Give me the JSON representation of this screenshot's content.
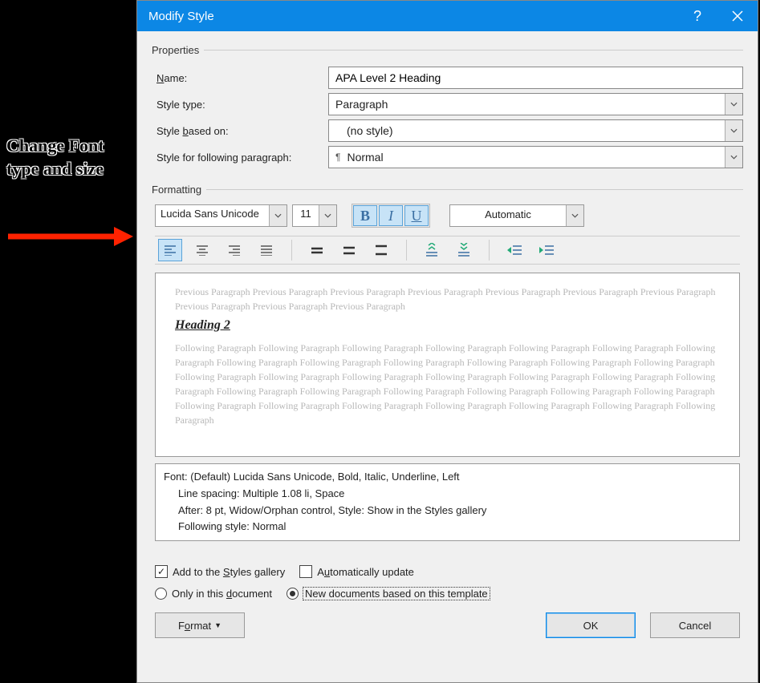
{
  "annotation": {
    "text": "Change Font type and size"
  },
  "dialog": {
    "title": "Modify Style",
    "help_icon": "?",
    "close_icon": "×"
  },
  "properties": {
    "legend": "Properties",
    "name_label": "Name:",
    "name_value": "APA Level 2 Heading",
    "type_label": "Style type:",
    "type_value": "Paragraph",
    "based_label": "Style based on:",
    "based_value": "(no style)",
    "follow_label": "Style for following paragraph:",
    "follow_value": "Normal"
  },
  "formatting": {
    "legend": "Formatting",
    "font_name": "Lucida Sans Unicode",
    "font_size": "11",
    "bold": "B",
    "italic": "I",
    "underline": "U",
    "color_auto": "Automatic"
  },
  "preview": {
    "prev_text": "Previous Paragraph Previous Paragraph Previous Paragraph Previous Paragraph Previous Paragraph Previous Paragraph Previous Paragraph Previous Paragraph Previous Paragraph Previous Paragraph",
    "heading": "Heading 2",
    "follow_text": "Following Paragraph Following Paragraph Following Paragraph Following Paragraph Following Paragraph Following Paragraph Following Paragraph Following Paragraph Following Paragraph Following Paragraph Following Paragraph Following Paragraph Following Paragraph Following Paragraph Following Paragraph Following Paragraph Following Paragraph Following Paragraph Following Paragraph Following Paragraph Following Paragraph Following Paragraph Following Paragraph Following Paragraph Following Paragraph Following Paragraph Following Paragraph Following Paragraph Following Paragraph Following Paragraph Following Paragraph Following Paragraph Following Paragraph"
  },
  "description": {
    "line1": "Font: (Default) Lucida Sans Unicode, Bold, Italic, Underline, Left",
    "line2": "Line spacing:  Multiple 1.08 li, Space",
    "line3": "After:  8 pt, Widow/Orphan control, Style: Show in the Styles gallery",
    "line4": "Following style: Normal"
  },
  "options": {
    "add_gallery": "Add to the Styles gallery",
    "auto_update": "Automatically update",
    "only_doc": "Only in this document",
    "template": "New documents based on this template"
  },
  "buttons": {
    "format": "Format",
    "ok": "OK",
    "cancel": "Cancel"
  },
  "accesskeys": {
    "name_u": "N",
    "based_u": "b",
    "follow_u": "s",
    "gallery_u": "S",
    "auto_u": "u",
    "only_u": "d",
    "format_u": "o"
  }
}
